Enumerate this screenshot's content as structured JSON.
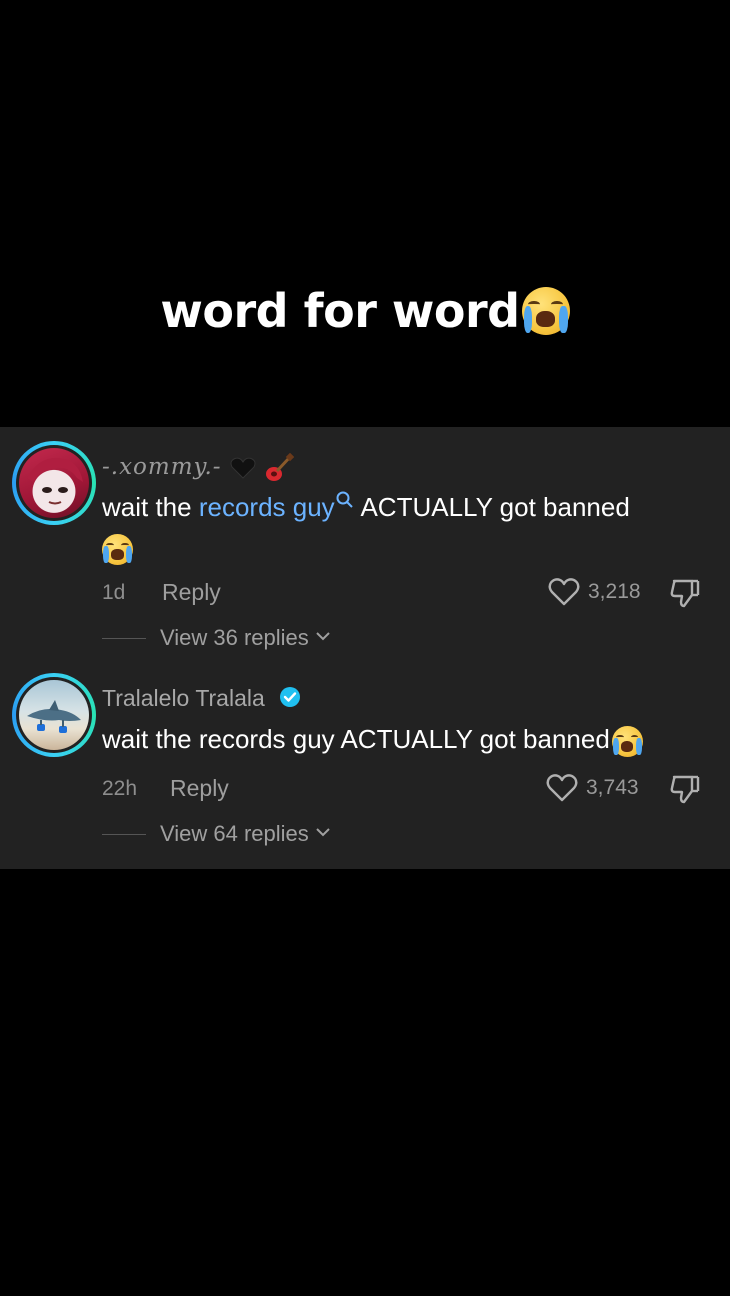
{
  "caption": {
    "text": "word for word",
    "emoji": "loudly-crying-emoji"
  },
  "comments": [
    {
      "username": "-.xommy.-",
      "username_emojis": [
        "black-heart-icon",
        "guitar-icon"
      ],
      "text_before": "wait the ",
      "link_text": "records guy",
      "text_after": " ACTUALLY got banned",
      "time": "1d",
      "reply_label": "Reply",
      "likes": "3,218",
      "view_replies": "View 36 replies"
    },
    {
      "username": "Tralalelo Tralala",
      "verified": true,
      "text": "wait the records guy ACTUALLY got banned",
      "time": "22h",
      "reply_label": "Reply",
      "likes": "3,743",
      "view_replies": "View 64 replies"
    }
  ],
  "colors": {
    "link": "#6cb3ff",
    "panel": "#222222",
    "verified": "#20c0f0"
  }
}
